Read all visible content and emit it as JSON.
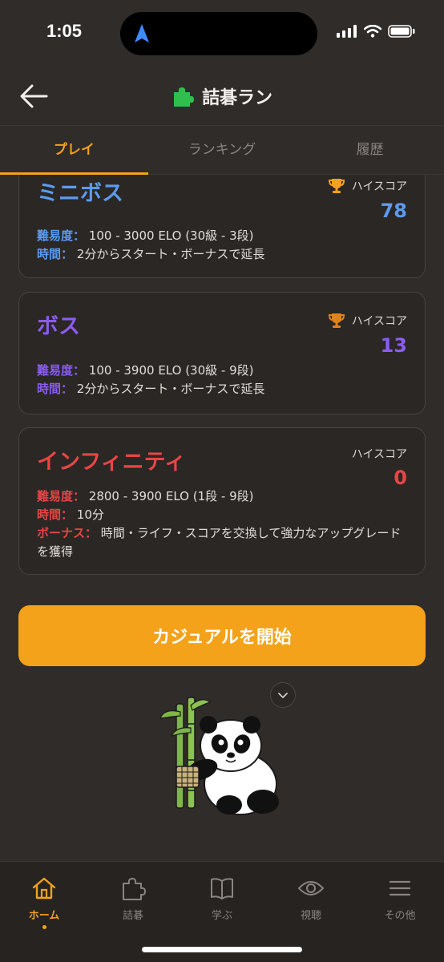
{
  "status_bar": {
    "time": "1:05"
  },
  "header": {
    "title": "詰碁ラン"
  },
  "tabs": [
    {
      "label": "プレイ",
      "active": true
    },
    {
      "label": "ランキング",
      "active": false
    },
    {
      "label": "履歴",
      "active": false
    }
  ],
  "modes": [
    {
      "name": "ミニボス",
      "color": "#5b9bf0",
      "highscore_label": "ハイスコア",
      "highscore": "78",
      "trophy": "trophy-icon",
      "difficulty_label": "難易度：",
      "difficulty": "100 - 3000 ELO (30級 - 3段)",
      "time_label": "時間：",
      "time": "2分からスタート・ボーナスで延長"
    },
    {
      "name": "ボス",
      "color": "#8b5cf0",
      "highscore_label": "ハイスコア",
      "highscore": "13",
      "trophy": "trophy-icon",
      "difficulty_label": "難易度：",
      "difficulty": "100 - 3900 ELO (30級 - 9段)",
      "time_label": "時間：",
      "time": "2分からスタート・ボーナスで延長"
    },
    {
      "name": "インフィニティ",
      "color": "#e84545",
      "highscore_label": "ハイスコア",
      "highscore": "0",
      "difficulty_label": "難易度：",
      "difficulty": "2800 - 3900 ELO (1段 - 9段)",
      "time_label": "時間：",
      "time": "10分",
      "bonus_label": "ボーナス：",
      "bonus": "時間・ライフ・スコアを交換して強力なアップグレードを獲得"
    }
  ],
  "start_button": {
    "label": "カジュアルを開始",
    "color": "#f4a21a"
  },
  "bottom_nav": [
    {
      "label": "ホーム",
      "icon": "home-icon",
      "active": true
    },
    {
      "label": "詰碁",
      "icon": "puzzle-icon",
      "active": false
    },
    {
      "label": "学ぶ",
      "icon": "book-icon",
      "active": false
    },
    {
      "label": "視聴",
      "icon": "eye-icon",
      "active": false
    },
    {
      "label": "その他",
      "icon": "menu-icon",
      "active": false
    }
  ]
}
